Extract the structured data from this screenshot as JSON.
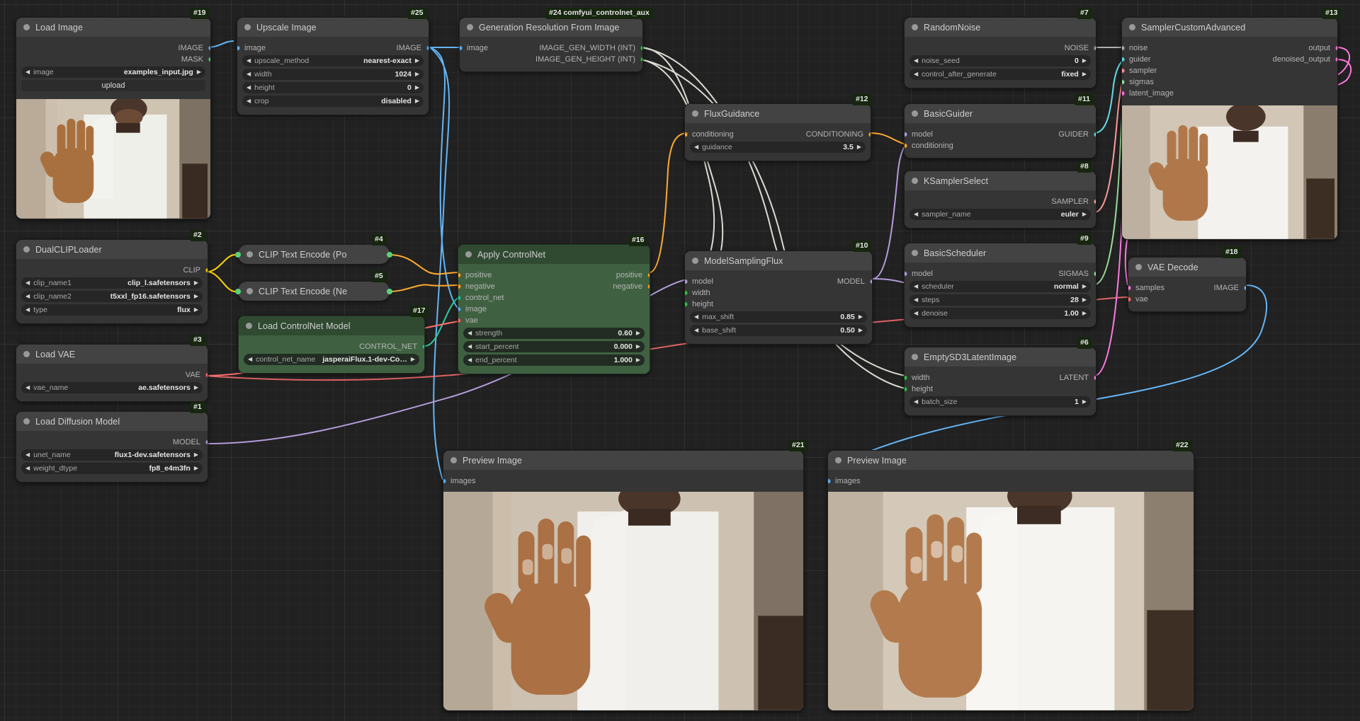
{
  "app": {
    "name": "ComfyUI",
    "canvas_bg": "#212121"
  },
  "colors": {
    "image": "#64b5f6",
    "mask": "#5bd17a",
    "clip": "#ffd500",
    "vae": "#ff6e6e",
    "model": "#b39ddb",
    "conditioning": "#ffa931",
    "control_net": "#2ecc9b",
    "int": "#2ecc40",
    "latent": "#ff79e1",
    "sampler": "#ff9b9b",
    "sigmas": "#9bdf9b",
    "guider": "#66d9e8",
    "noise": "#b0b0b0",
    "header_green": "#2f4a31"
  },
  "nodes": {
    "load_image": {
      "badge": "#19",
      "title": "Load Image",
      "outputs": [
        {
          "label": "IMAGE",
          "type": "image"
        },
        {
          "label": "MASK",
          "type": "mask"
        }
      ],
      "widgets": [
        {
          "name": "image",
          "value": "examples_input.jpg"
        }
      ],
      "button": "upload"
    },
    "dual_clip_loader": {
      "badge": "#2",
      "title": "DualCLIPLoader",
      "outputs": [
        {
          "label": "CLIP",
          "type": "clip"
        }
      ],
      "widgets": [
        {
          "name": "clip_name1",
          "value": "clip_l.safetensors"
        },
        {
          "name": "clip_name2",
          "value": "t5xxl_fp16.safetensors"
        },
        {
          "name": "type",
          "value": "flux"
        }
      ]
    },
    "load_vae": {
      "badge": "#3",
      "title": "Load VAE",
      "outputs": [
        {
          "label": "VAE",
          "type": "vae"
        }
      ],
      "widgets": [
        {
          "name": "vae_name",
          "value": "ae.safetensors"
        }
      ]
    },
    "load_diffusion_model": {
      "badge": "#1",
      "title": "Load Diffusion Model",
      "outputs": [
        {
          "label": "MODEL",
          "type": "model"
        }
      ],
      "widgets": [
        {
          "name": "unet_name",
          "value": "flux1-dev.safetensors"
        },
        {
          "name": "weight_dtype",
          "value": "fp8_e4m3fn"
        }
      ]
    },
    "upscale_image": {
      "badge": "#25",
      "title": "Upscale Image",
      "inputs": [
        {
          "label": "image",
          "type": "image"
        }
      ],
      "outputs": [
        {
          "label": "IMAGE",
          "type": "image"
        }
      ],
      "widgets": [
        {
          "name": "upscale_method",
          "value": "nearest-exact"
        },
        {
          "name": "width",
          "value": "1024"
        },
        {
          "name": "height",
          "value": "0"
        },
        {
          "name": "crop",
          "value": "disabled"
        }
      ]
    },
    "gen_resolution": {
      "badge": "#24 comfyui_controlnet_aux",
      "title": "Generation Resolution From Image",
      "inputs": [
        {
          "label": "image",
          "type": "image"
        }
      ],
      "outputs": [
        {
          "label": "IMAGE_GEN_WIDTH (INT)",
          "type": "int"
        },
        {
          "label": "IMAGE_GEN_HEIGHT (INT)",
          "type": "int"
        }
      ]
    },
    "clip_text_positive": {
      "badge": "#4",
      "title": "CLIP Text Encode (Po",
      "collapsed": true
    },
    "clip_text_negative": {
      "badge": "#5",
      "title": "CLIP Text Encode (Ne",
      "collapsed": true
    },
    "load_controlnet_model": {
      "badge": "#17",
      "title": "Load ControlNet Model",
      "outputs": [
        {
          "label": "CONTROL_NET",
          "type": "control_net"
        }
      ],
      "widgets": [
        {
          "name": "control_net_name",
          "value": "jasperaiFlux.1-dev-Co…"
        }
      ]
    },
    "apply_controlnet": {
      "badge": "#16",
      "title": "Apply ControlNet",
      "inputs": [
        {
          "label": "positive",
          "type": "conditioning"
        },
        {
          "label": "negative",
          "type": "conditioning"
        },
        {
          "label": "control_net",
          "type": "control_net"
        },
        {
          "label": "image",
          "type": "image"
        },
        {
          "label": "vae",
          "type": "vae"
        }
      ],
      "outputs": [
        {
          "label": "positive",
          "type": "conditioning"
        },
        {
          "label": "negative",
          "type": "conditioning"
        }
      ],
      "widgets": [
        {
          "name": "strength",
          "value": "0.60"
        },
        {
          "name": "start_percent",
          "value": "0.000"
        },
        {
          "name": "end_percent",
          "value": "1.000"
        }
      ]
    },
    "flux_guidance": {
      "badge": "#12",
      "title": "FluxGuidance",
      "inputs": [
        {
          "label": "conditioning",
          "type": "conditioning"
        }
      ],
      "outputs": [
        {
          "label": "CONDITIONING",
          "type": "conditioning"
        }
      ],
      "widgets": [
        {
          "name": "guidance",
          "value": "3.5"
        }
      ]
    },
    "model_sampling_flux": {
      "badge": "#10",
      "title": "ModelSamplingFlux",
      "inputs": [
        {
          "label": "model",
          "type": "model"
        },
        {
          "label": "width",
          "type": "int"
        },
        {
          "label": "height",
          "type": "int"
        }
      ],
      "outputs": [
        {
          "label": "MODEL",
          "type": "model"
        }
      ],
      "widgets": [
        {
          "name": "max_shift",
          "value": "0.85"
        },
        {
          "name": "base_shift",
          "value": "0.50"
        }
      ]
    },
    "random_noise": {
      "badge": "#7",
      "title": "RandomNoise",
      "outputs": [
        {
          "label": "NOISE",
          "type": "noise"
        }
      ],
      "widgets": [
        {
          "name": "noise_seed",
          "value": "0"
        },
        {
          "name": "control_after_generate",
          "value": "fixed"
        }
      ]
    },
    "basic_guider": {
      "badge": "#11",
      "title": "BasicGuider",
      "inputs": [
        {
          "label": "model",
          "type": "model"
        },
        {
          "label": "conditioning",
          "type": "conditioning"
        }
      ],
      "outputs": [
        {
          "label": "GUIDER",
          "type": "guider"
        }
      ]
    },
    "ksampler_select": {
      "badge": "#8",
      "title": "KSamplerSelect",
      "outputs": [
        {
          "label": "SAMPLER",
          "type": "sampler"
        }
      ],
      "widgets": [
        {
          "name": "sampler_name",
          "value": "euler"
        }
      ]
    },
    "basic_scheduler": {
      "badge": "#9",
      "title": "BasicScheduler",
      "inputs": [
        {
          "label": "model",
          "type": "model"
        }
      ],
      "outputs": [
        {
          "label": "SIGMAS",
          "type": "sigmas"
        }
      ],
      "widgets": [
        {
          "name": "scheduler",
          "value": "normal"
        },
        {
          "name": "steps",
          "value": "28"
        },
        {
          "name": "denoise",
          "value": "1.00"
        }
      ]
    },
    "empty_latent": {
      "badge": "#6",
      "title": "EmptySD3LatentImage",
      "inputs": [
        {
          "label": "width",
          "type": "int"
        },
        {
          "label": "height",
          "type": "int"
        }
      ],
      "outputs": [
        {
          "label": "LATENT",
          "type": "latent"
        }
      ],
      "widgets": [
        {
          "name": "batch_size",
          "value": "1"
        }
      ]
    },
    "sampler_custom_advanced": {
      "badge": "#13",
      "title": "SamplerCustomAdvanced",
      "inputs": [
        {
          "label": "noise",
          "type": "noise"
        },
        {
          "label": "guider",
          "type": "guider"
        },
        {
          "label": "sampler",
          "type": "sampler"
        },
        {
          "label": "sigmas",
          "type": "sigmas"
        },
        {
          "label": "latent_image",
          "type": "latent"
        }
      ],
      "outputs": [
        {
          "label": "output",
          "type": "latent"
        },
        {
          "label": "denoised_output",
          "type": "latent"
        }
      ]
    },
    "vae_decode": {
      "badge": "#18",
      "title": "VAE Decode",
      "inputs": [
        {
          "label": "samples",
          "type": "latent"
        },
        {
          "label": "vae",
          "type": "vae"
        }
      ],
      "outputs": [
        {
          "label": "IMAGE",
          "type": "image"
        }
      ]
    },
    "preview_image_1": {
      "badge": "#21",
      "title": "Preview Image",
      "inputs": [
        {
          "label": "images",
          "type": "image"
        }
      ]
    },
    "preview_image_2": {
      "badge": "#22",
      "title": "Preview Image",
      "inputs": [
        {
          "label": "images",
          "type": "image"
        }
      ]
    }
  }
}
